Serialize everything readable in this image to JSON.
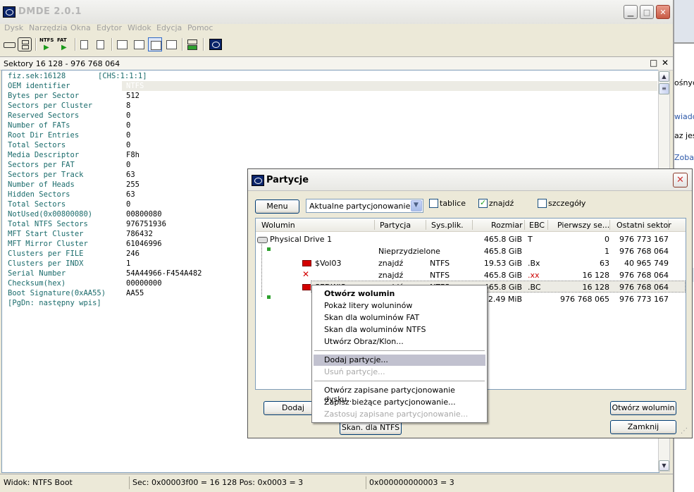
{
  "app": {
    "title": "DMDE 2.0.1"
  },
  "menu": [
    "Dysk",
    "Narzędzia",
    "Okna",
    "Edytor",
    "Widok",
    "Edycja",
    "Pomoc"
  ],
  "toolbar": {
    "ntfs_label": "NTFS",
    "fat_label": "FAT"
  },
  "sectors_header": "Sektory 16 128 - 976 768 064",
  "boot_sector": {
    "header_key": "fiz.sek:16128",
    "header_value": "[CHS:1:1:1]",
    "rows": [
      {
        "key": "OEM identifier",
        "value": "NTFS"
      },
      {
        "key": "Bytes per Sector",
        "value": "512"
      },
      {
        "key": "Sectors per Cluster",
        "value": "8"
      },
      {
        "key": "Reserved Sectors",
        "value": "0"
      },
      {
        "key": "Number of FATs",
        "value": "0"
      },
      {
        "key": "Root Dir Entries",
        "value": "0"
      },
      {
        "key": "Total Sectors",
        "value": "0"
      },
      {
        "key": "Media Descriptor",
        "value": "F8h"
      },
      {
        "key": "Sectors per FAT",
        "value": "0"
      },
      {
        "key": "Sectors per Track",
        "value": "63"
      },
      {
        "key": "Number of Heads",
        "value": "255"
      },
      {
        "key": "Hidden Sectors",
        "value": "63"
      },
      {
        "key": "Total Sectors",
        "value": "0"
      },
      {
        "key": "NotUsed(0x00800080)",
        "value": "00800080"
      },
      {
        "key": "Total NTFS Sectors",
        "value": "976751936"
      },
      {
        "key": "MFT Start Cluster",
        "value": "786432"
      },
      {
        "key": "MFT Mirror Cluster",
        "value": "61046996"
      },
      {
        "key": "Clusters per FILE",
        "value": "246"
      },
      {
        "key": "Clusters per INDX",
        "value": "1"
      },
      {
        "key": "Serial Number",
        "value": "54A44966-F454A482"
      },
      {
        "key": "Checksum(hex)",
        "value": "00000000"
      },
      {
        "key": "Boot Signature(0xAA55)",
        "value": "AA55"
      }
    ],
    "footer": "[PgDn: następny wpis]"
  },
  "status": {
    "view": "Widok: NTFS Boot",
    "position": "Sec: 0x00003f00 = 16 128  Pos: 0x0003 = 3",
    "value": "0x000000000003 = 3"
  },
  "background_window": {
    "lines": [
      "ośnyc",
      "wiado",
      "az jes",
      "Zobac"
    ]
  },
  "dialog": {
    "title": "Partycje",
    "menu_button": "Menu",
    "combo_value": "Aktualne partycjonowanie",
    "checkboxes": [
      {
        "label": "tablice",
        "checked": false
      },
      {
        "label": "znajdź",
        "checked": true
      },
      {
        "label": "szczegóły",
        "checked": false
      }
    ],
    "columns": [
      "Wolumin",
      "Partycja",
      "Sys.plik.",
      "Rozmiar",
      "EBC",
      "Pierwszy se...",
      "Ostatni sektor"
    ],
    "rows": [
      {
        "wolumin": "Physical Drive 1",
        "partycja": "",
        "sys": "",
        "rozmiar": "465.8 GiB",
        "ebc": "T",
        "first": "0",
        "last": "976 773 167"
      },
      {
        "wolumin": "",
        "partycja": "Nieprzydzielone",
        "sys": "",
        "rozmiar": "465.8 GiB",
        "ebc": "",
        "first": "1",
        "last": "976 768 064"
      },
      {
        "wolumin": "$Vol03",
        "partycja": "znajdź",
        "sys": "NTFS",
        "rozmiar": "19.53 GiB",
        "ebc": ".Bx",
        "first": "63",
        "last": "40 965 749"
      },
      {
        "wolumin": "",
        "partycja": "znajdź",
        "sys": "NTFS",
        "rozmiar": "465.8 GiB",
        "ebc": ".xx",
        "first": "16 128",
        "last": "976 768 064"
      },
      {
        "wolumin": "SEDWIS",
        "partycja": "znajdź",
        "sys": "NTFS",
        "rozmiar": "465.8 GiB",
        "ebc": ".BC",
        "first": "16 128",
        "last": "976 768 064"
      },
      {
        "wolumin": "",
        "partycja": "",
        "sys": "",
        "rozmiar": "2.49 MiB",
        "ebc": "",
        "first": "976 768 065",
        "last": "976 773 167"
      }
    ],
    "buttons": {
      "add": "Dodaj",
      "scan_ntfs": "Skan. dla NTFS",
      "open_volume": "Otwórz wolumin",
      "close": "Zamknij"
    }
  },
  "context_menu": {
    "items": [
      {
        "label": "Otwórz wolumin",
        "bold": true,
        "disabled": false
      },
      {
        "label": "Pokaż litery woluninów",
        "disabled": false
      },
      {
        "label": "Skan dla woluminów FAT",
        "disabled": false
      },
      {
        "label": "Skan dla woluminów NTFS",
        "disabled": false
      },
      {
        "label": "Utwórz Obraz/Klon...",
        "disabled": false
      },
      {
        "label": "Dodaj partycje...",
        "disabled": false,
        "highlighted": true
      },
      {
        "label": "Usuń partycje...",
        "disabled": true
      },
      {
        "label": "Otwórz zapisane partycjonowanie dysku...",
        "disabled": false
      },
      {
        "label": "Zapisz bieżące partycjonowanie...",
        "disabled": false
      },
      {
        "label": "Zastosuj zapisane partycjonowanie...",
        "disabled": true
      }
    ]
  },
  "colors": {
    "key_text": "#1a6b6b",
    "highlight_row": "#ecebe4",
    "menu_highlight": "#c1c1cf",
    "ebc_red": "#cc0000"
  }
}
